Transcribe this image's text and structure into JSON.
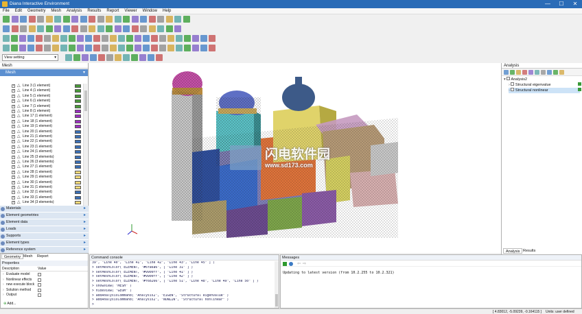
{
  "window": {
    "title": "Diana Interactive Environment",
    "minimize": "—",
    "maximize": "☐",
    "close": "✕"
  },
  "menu": [
    "File",
    "Edit",
    "Geometry",
    "Mesh",
    "Analysis",
    "Results",
    "Report",
    "Viewer",
    "Window",
    "Help"
  ],
  "view_setting": {
    "value": "View setting",
    "arrow": "▾"
  },
  "mesh_panel": {
    "title": "Mesh",
    "items": [
      {
        "label": "Line 3 (1 element)",
        "color": "#4a9a3a"
      },
      {
        "label": "Line 4 (1 element)",
        "color": "#4a9a3a"
      },
      {
        "label": "Line 5 (1 element)",
        "color": "#4a9a3a"
      },
      {
        "label": "Line 6 (1 element)",
        "color": "#4a9a3a"
      },
      {
        "label": "Line 7 (1 element)",
        "color": "#4a9a3a"
      },
      {
        "label": "Line 8 (1 element)",
        "color": "#9b2fc0"
      },
      {
        "label": "Line 17 (1 element)",
        "color": "#9b2fc0"
      },
      {
        "label": "Line 18 (1 element)",
        "color": "#9b2fc0"
      },
      {
        "label": "Line 19 (1 element)",
        "color": "#9b2fc0"
      },
      {
        "label": "Line 20 (1 element)",
        "color": "#3b6fb5"
      },
      {
        "label": "Line 21 (1 element)",
        "color": "#3b6fb5"
      },
      {
        "label": "Line 22 (1 element)",
        "color": "#3b6fb5"
      },
      {
        "label": "Line 23 (1 element)",
        "color": "#3b6fb5"
      },
      {
        "label": "Line 24 (1 element)",
        "color": "#3b6fb5"
      },
      {
        "label": "Line 25 (3 elements)",
        "color": "#3b6fb5"
      },
      {
        "label": "Line 26 (3 elements)",
        "color": "#3b6fb5"
      },
      {
        "label": "Line 27 (1 element)",
        "color": "#3b6fb5"
      },
      {
        "label": "Line 28 (1 element)",
        "color": "#f0d878"
      },
      {
        "label": "Line 29 (1 element)",
        "color": "#f0d878"
      },
      {
        "label": "Line 30 (1 element)",
        "color": "#f0d878"
      },
      {
        "label": "Line 31 (1 element)",
        "color": "#f0d878"
      },
      {
        "label": "Line 32 (1 element)",
        "color": "#3b6fb5"
      },
      {
        "label": "Line 33 (1 element)",
        "color": "#3b6fb5"
      },
      {
        "label": "Line 34 (3 elements)",
        "color": "#f0d878"
      }
    ]
  },
  "sections": [
    "Materials",
    "Element geometries",
    "Element data",
    "Loads",
    "Supports",
    "Element types",
    "Reference system"
  ],
  "properties": {
    "tabs": [
      "Geometry",
      "Mesh",
      "Report"
    ],
    "title": "Properties",
    "col_description": "Description",
    "col_value": "Value",
    "rows": [
      "Evaluate model",
      "Nonlinear effects",
      "new execute block",
      "Solution method",
      "Output"
    ],
    "add_label": "Add..."
  },
  "console": {
    "title": "Command console",
    "lines": [
      "39\", \"Line 40\", \"Line 41\", \"Line 42\", \"Line 43\", \"Line 45\" ] )",
      "> setMeshColor( ELEMENT, \"#6fa6a6\", [ \"Line 31\" ] )",
      "> setMeshColor( ELEMENT, \"#9900ff\", [ \"Line 41\" ] )",
      "> setMeshColor( ELEMENT, \"#9900ff\", [ \"Line 42\" ] )",
      "> setMeshColor( ELEMENT, \"#f6b266\", [ \"Line 51\", \"Line 48\", \"Line 49\", \"Line 50\" ] )",
      "> showView( \"MESH\" )",
      "> hideView( \"GEOM\" )",
      "> addAnalysisCommand( \"Analysis2\", \"EIGEN\", \"Structural eigenvalue\" )",
      "> addAnalysisCommand( \"Analysis2\", \"NONLIN\", \"Structural nonlinear\" )",
      ">"
    ]
  },
  "messages": {
    "title": "Messages",
    "text": "Updating to latest version (from 10.2.255 to 10.2.321)"
  },
  "analysis": {
    "title": "Analysis",
    "root": "Analysis2",
    "items": [
      "Structural eigenvalue",
      "Structural nonlinear"
    ],
    "tabs": [
      "Analysis",
      "Results"
    ]
  },
  "status": {
    "coords": "[ 4.83012, -5.09239, -0.164115 ]",
    "units": "Units: user defined"
  },
  "watermark": {
    "cn": "闪电软件园",
    "url": "www.sd173.com"
  },
  "colors": {
    "titlebar": "#2b6cb7",
    "panel_header": "#dce6f2",
    "accent": "#2a6ebd",
    "selection": "#cde3f7"
  }
}
